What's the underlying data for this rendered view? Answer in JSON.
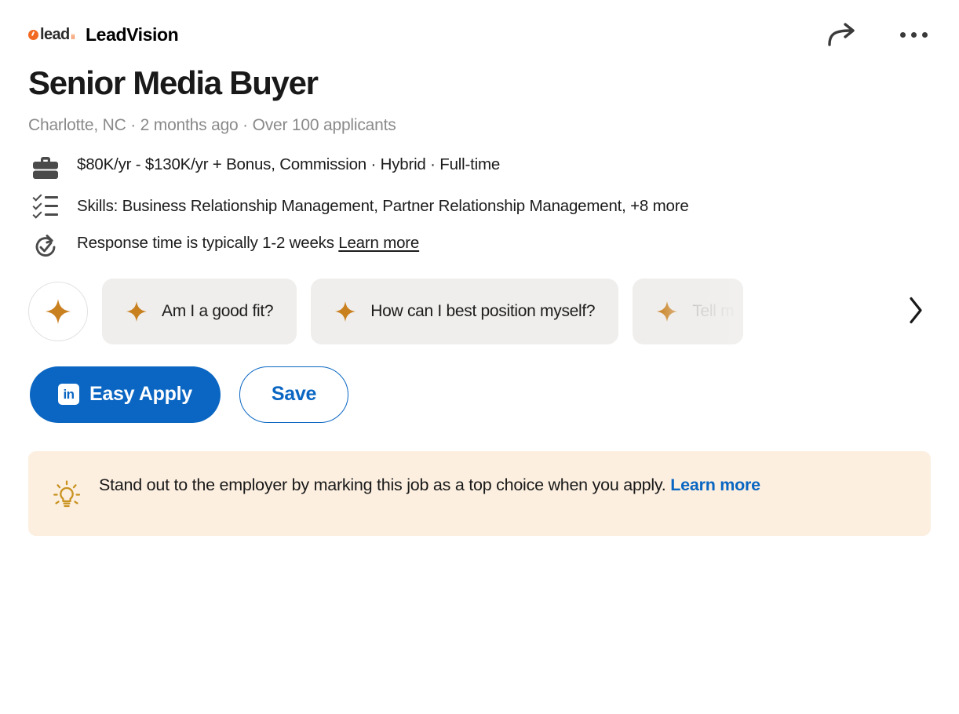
{
  "header": {
    "company_name": "LeadVision",
    "logo_word": "lead",
    "logo_tail": "ii",
    "share_icon": "share-arrow-icon",
    "more_icon": "more-options-icon"
  },
  "job": {
    "title": "Senior Media Buyer",
    "meta": "Charlotte, NC · 2 months ago · Over 100 applicants",
    "salary_row": "$80K/yr - $130K/yr + Bonus, Commission · Hybrid · Full-time",
    "skills_row": "Skills: Business Relationship Management, Partner Relationship Management, +8 more",
    "response_row": "Response time is typically 1-2 weeks",
    "response_link": "Learn more"
  },
  "chips": {
    "sparkle_button": "ai-sparkle-button",
    "items": [
      {
        "label": "Am I a good fit?"
      },
      {
        "label": "How can I best position myself?"
      },
      {
        "label": "Tell m"
      }
    ],
    "scroll_next": "scroll-right-chevron"
  },
  "actions": {
    "apply_label": "Easy Apply",
    "apply_badge": "in",
    "save_label": "Save"
  },
  "banner": {
    "text": "Stand out to the employer by marking this job as a top choice when you apply.",
    "link": "Learn more"
  },
  "colors": {
    "accent_blue": "#0a66c2",
    "sparkle_orange": "#C9801F",
    "logo_orange": "#F26A21",
    "banner_bg": "#fcefe0",
    "chip_bg": "#f0eeec"
  }
}
